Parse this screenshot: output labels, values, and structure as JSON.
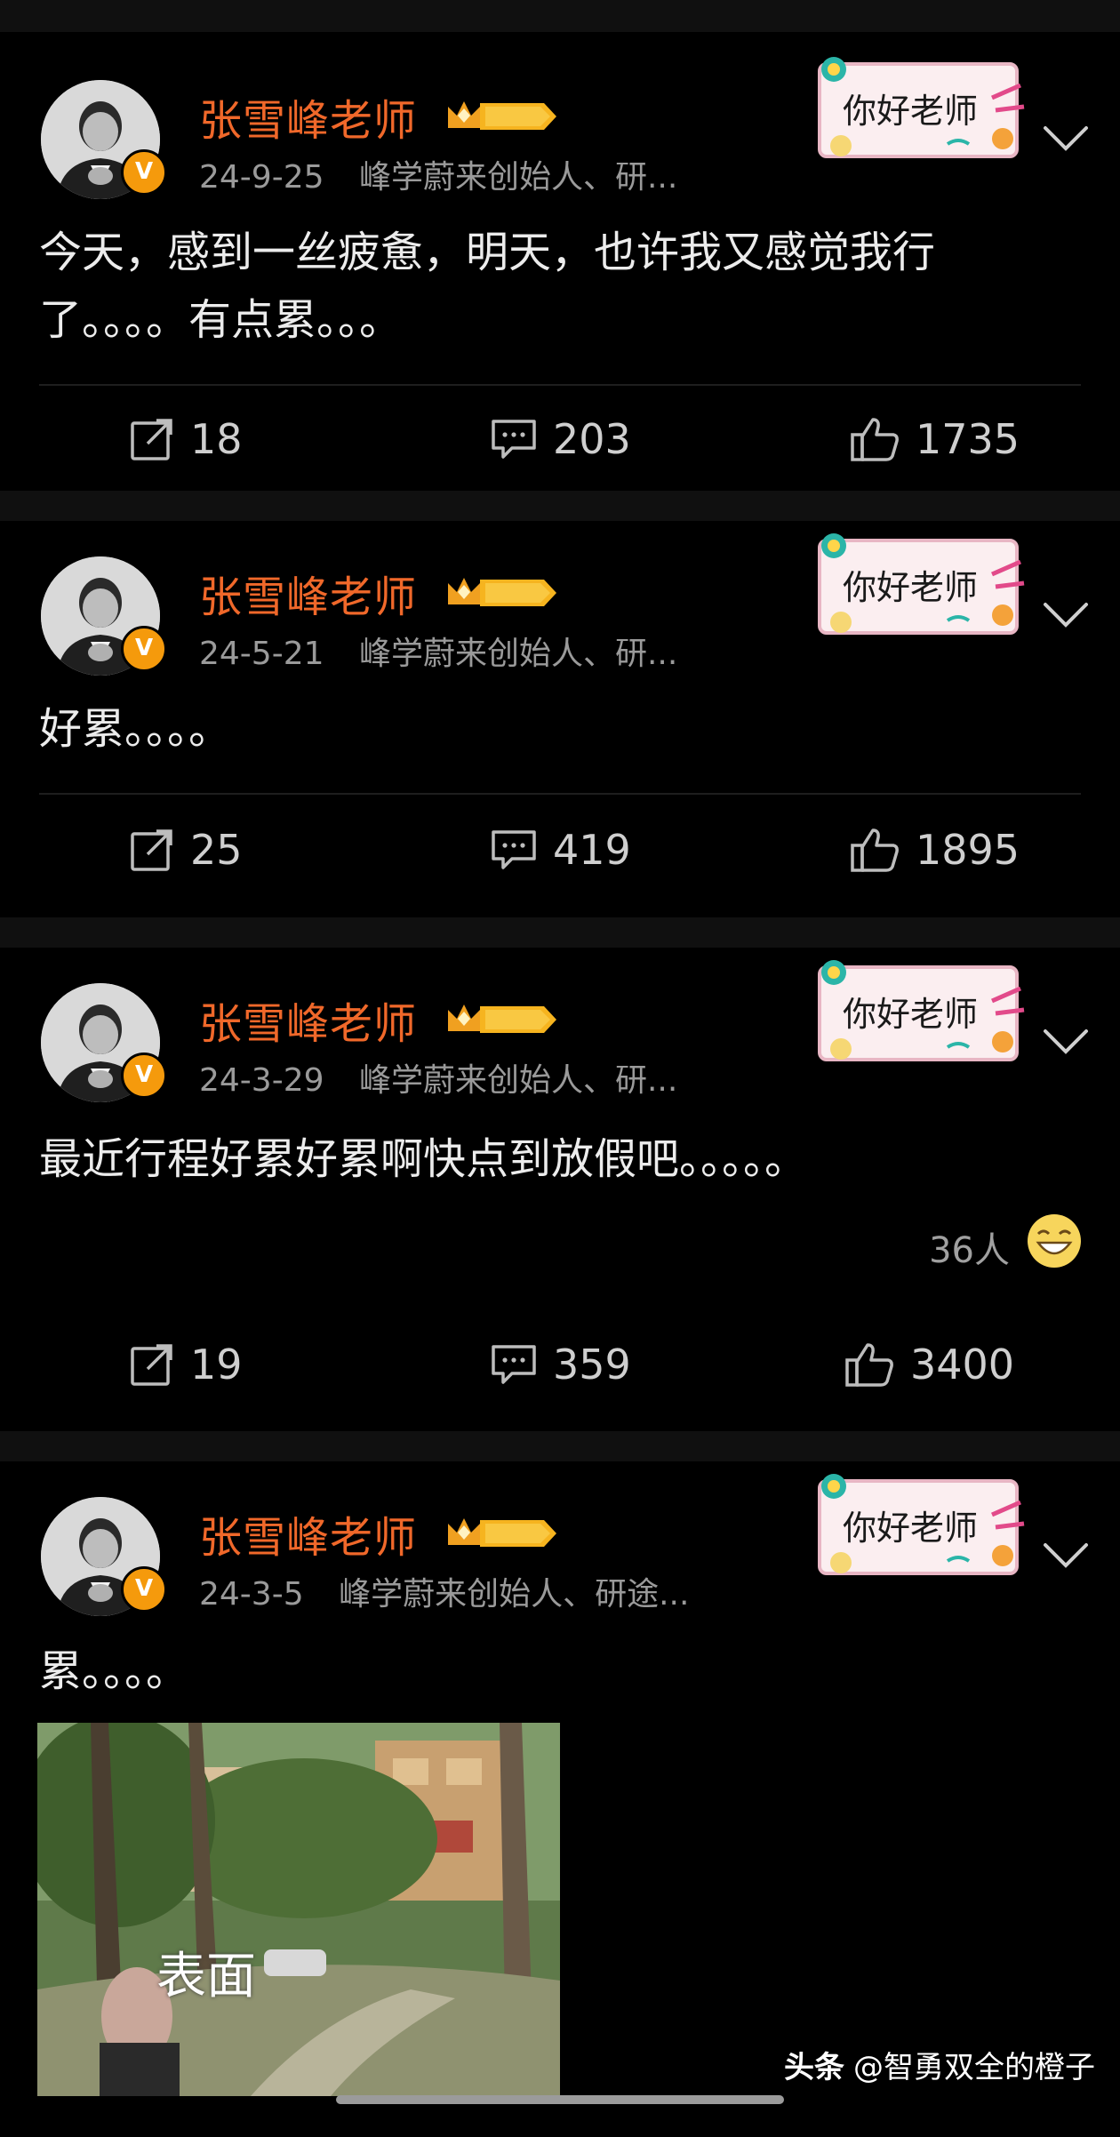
{
  "posts": [
    {
      "author": "张雪峰老师",
      "level_badge": "II",
      "verified_badge": "V",
      "sticker_text": "你好老师",
      "date": "24-9-25",
      "bio": "峰学蔚来创始人、研...",
      "text": "今天，感到一丝疲惫，明天，也许我又感觉我行了。。。。有点累。。。",
      "reposts": "18",
      "comments": "203",
      "likes": "1735"
    },
    {
      "author": "张雪峰老师",
      "level_badge": "II",
      "verified_badge": "V",
      "sticker_text": "你好老师",
      "date": "24-5-21",
      "bio": "峰学蔚来创始人、研...",
      "text": "好累。。。。",
      "reposts": "25",
      "comments": "419",
      "likes": "1895"
    },
    {
      "author": "张雪峰老师",
      "level_badge": "II",
      "verified_badge": "V",
      "sticker_text": "你好老师",
      "date": "24-3-29",
      "bio": "峰学蔚来创始人、研...",
      "text": "最近行程好累好累啊快点到放假吧。。。。。",
      "reaction_count": "36人",
      "reposts": "19",
      "comments": "359",
      "likes": "3400"
    },
    {
      "author": "张雪峰老师",
      "level_badge": "II",
      "verified_badge": "V",
      "sticker_text": "你好老师",
      "date": "24-3-5",
      "bio": "峰学蔚来创始人、研途...",
      "text": "累。。。。",
      "image_caption": "表面"
    }
  ],
  "watermark": {
    "brand": "头条",
    "handle": "@智勇双全的橙子"
  },
  "icons": {
    "repost": "repost-icon",
    "comment": "comment-icon",
    "like": "thumbs-up-icon",
    "more": "chevron-down-icon",
    "reaction": "grinning-emoji-icon"
  },
  "colors": {
    "author_name": "#f0682a",
    "verified": "#f59a0c",
    "background": "#000000",
    "separator": "#101010"
  }
}
